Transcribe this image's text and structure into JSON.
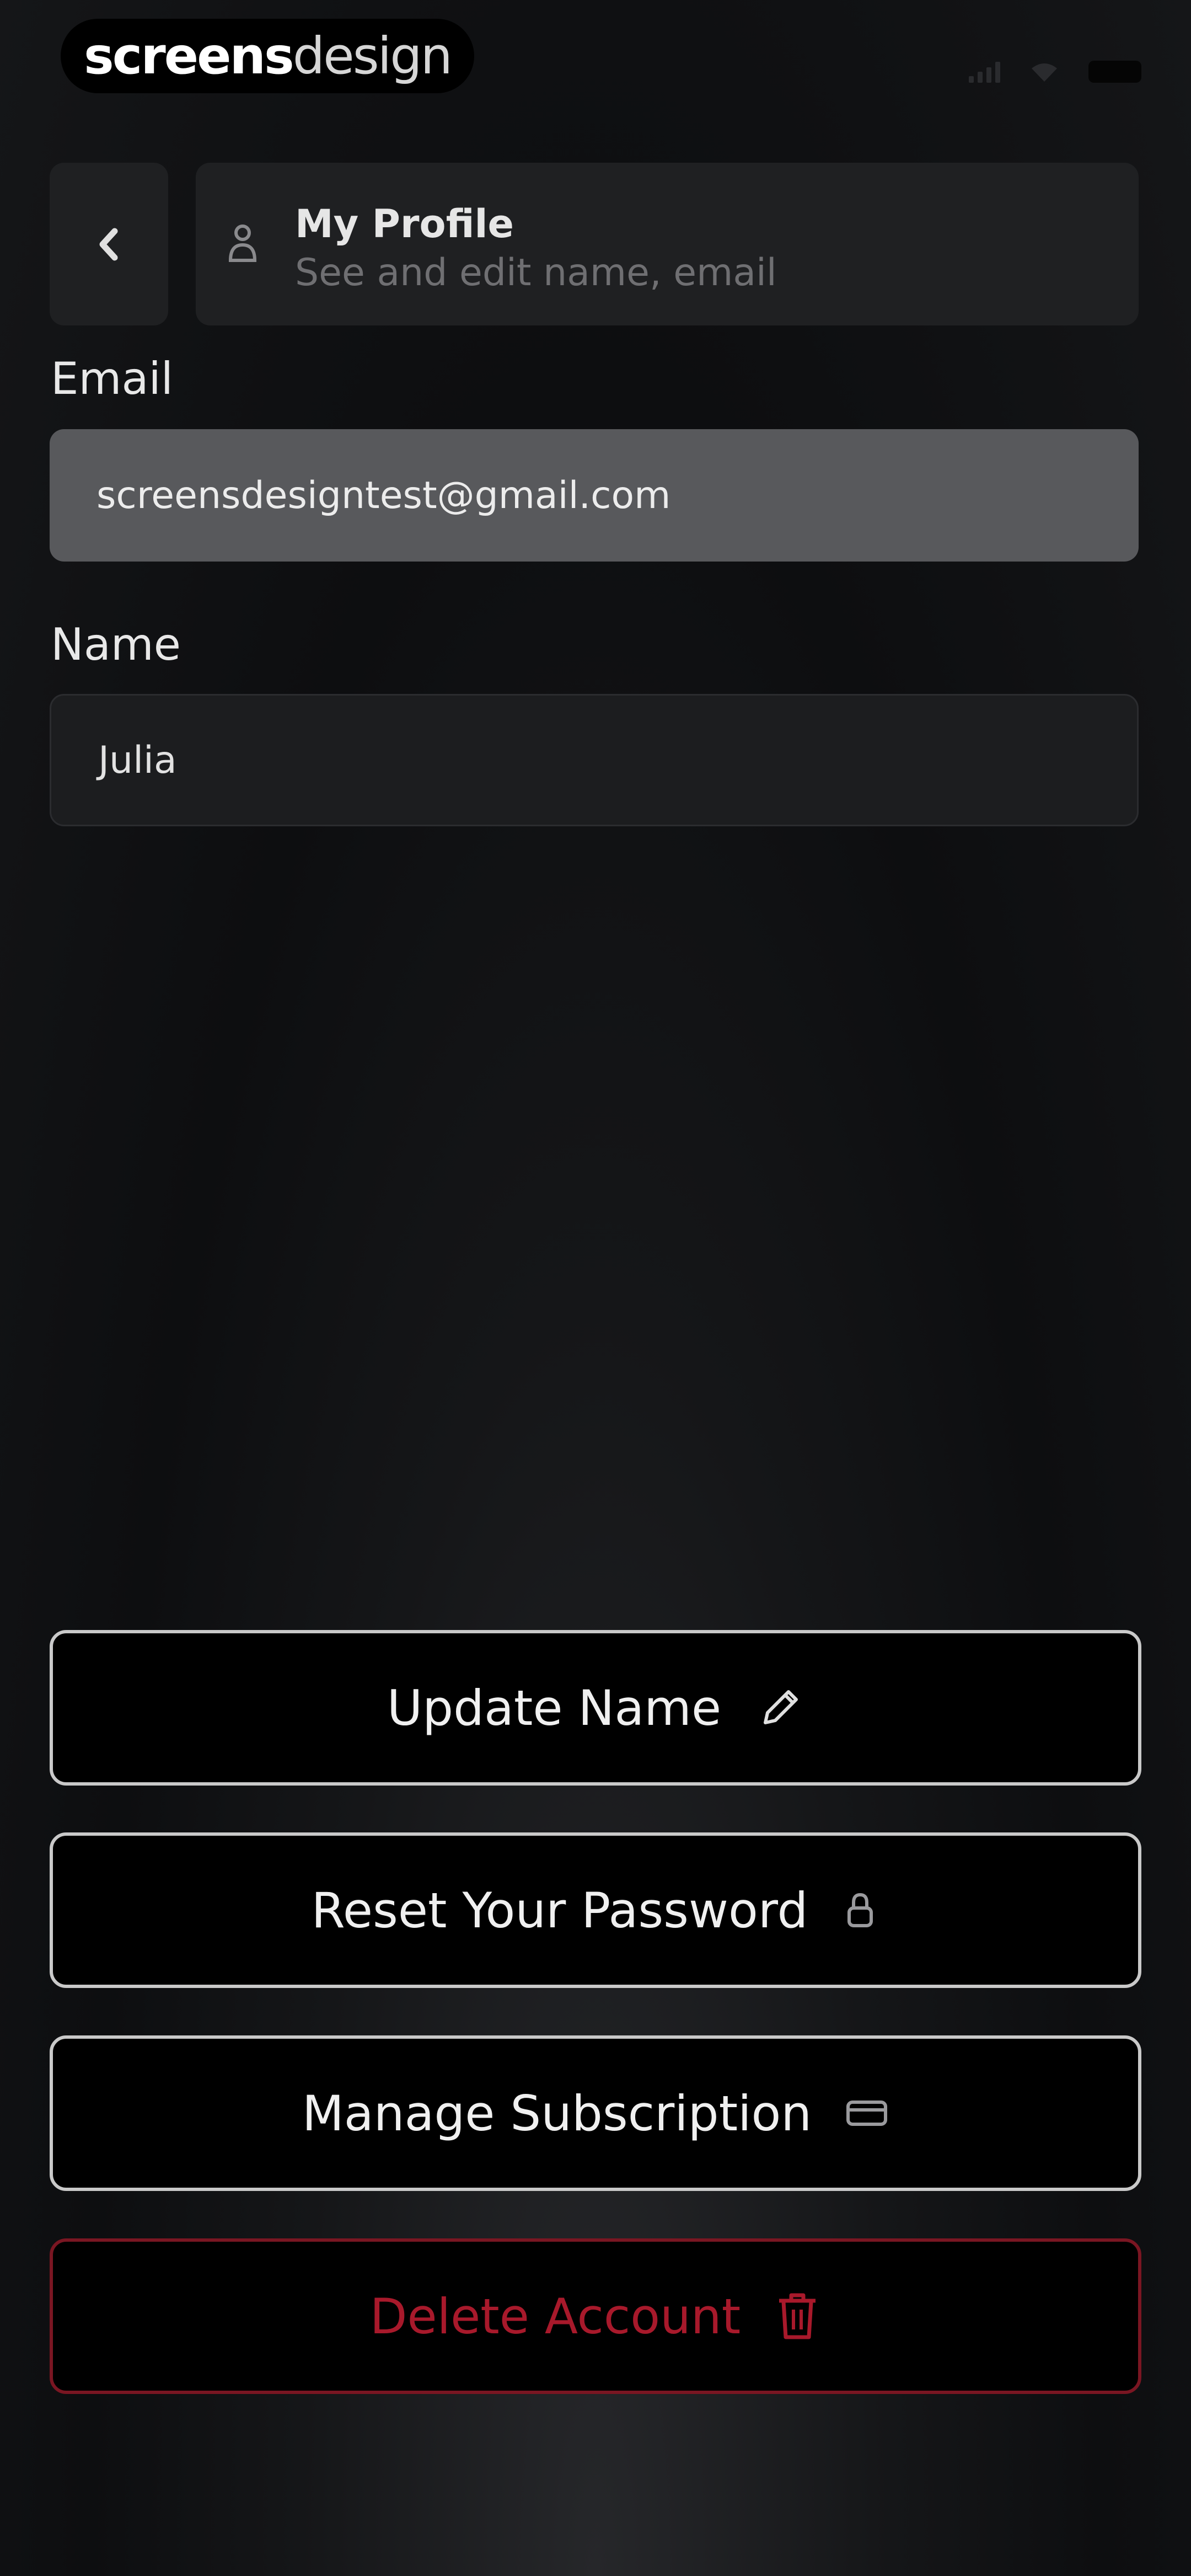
{
  "brand": {
    "part1": "screens",
    "part2": "design"
  },
  "header": {
    "title": "My Profile",
    "subtitle": "See and edit name, email"
  },
  "form": {
    "email_label": "Email",
    "email_value": "screensdesigntest@gmail.com",
    "name_label": "Name",
    "name_value": "Julia"
  },
  "actions": {
    "update_name": "Update Name",
    "reset_password": "Reset Your Password",
    "manage_subscription": "Manage Subscription",
    "delete_account": "Delete Account"
  },
  "icons": {
    "back": "chevron-left-icon",
    "profile": "user-icon",
    "update_name": "pencil-icon",
    "reset_password": "lock-icon",
    "manage_subscription": "credit-card-icon",
    "delete_account": "trash-icon"
  },
  "colors": {
    "background": "#111214",
    "card": "#1f2022",
    "email_field": "#58595c",
    "button_border": "#c9c9c9",
    "danger": "#a8192b"
  }
}
